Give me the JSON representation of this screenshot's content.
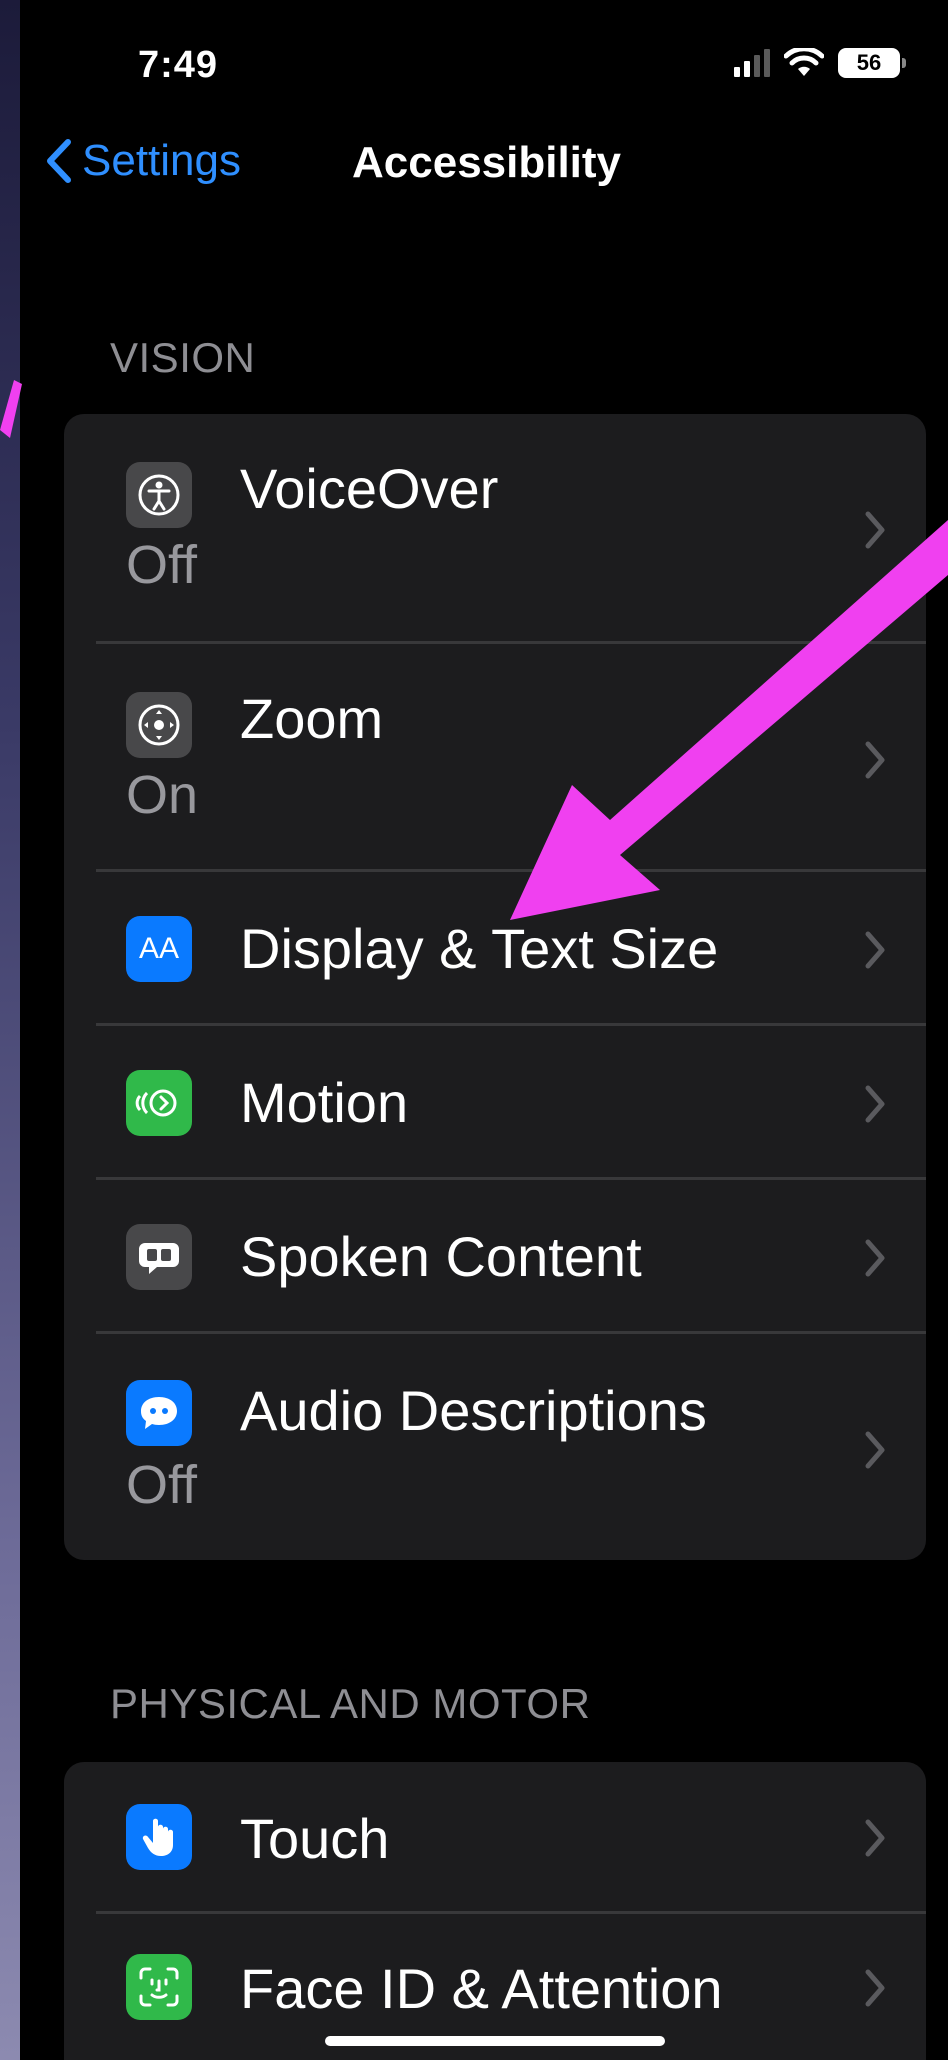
{
  "status_bar": {
    "time": "7:49",
    "battery": "56"
  },
  "nav": {
    "back_label": "Settings",
    "title": "Accessibility"
  },
  "sections": {
    "vision": {
      "header": "VISION",
      "rows": [
        {
          "label": "VoiceOver",
          "value": "Off",
          "icon": "voiceover-icon",
          "icon_bg": "#48484a"
        },
        {
          "label": "Zoom",
          "value": "On",
          "icon": "zoom-icon",
          "icon_bg": "#48484a"
        },
        {
          "label": "Display & Text Size",
          "icon": "display-text-size-icon",
          "icon_glyph": "AA",
          "icon_bg": "#0a7aff"
        },
        {
          "label": "Motion",
          "icon": "motion-icon",
          "icon_bg": "#30b94a"
        },
        {
          "label": "Spoken Content",
          "icon": "spoken-content-icon",
          "icon_bg": "#48484a"
        },
        {
          "label": "Audio Descriptions",
          "value": "Off",
          "icon": "audio-descriptions-icon",
          "icon_bg": "#0a7aff"
        }
      ]
    },
    "physical_motor": {
      "header": "PHYSICAL AND MOTOR",
      "rows": [
        {
          "label": "Touch",
          "icon": "touch-icon",
          "icon_bg": "#0a7aff"
        },
        {
          "label": "Face ID & Attention",
          "icon": "face-id-icon",
          "icon_bg": "#30b94a"
        }
      ]
    }
  },
  "colors": {
    "accent": "#2f8fff",
    "annotation_arrow": "#f040f0",
    "cell_bg": "#1c1c1e",
    "secondary_text": "#98989d"
  }
}
